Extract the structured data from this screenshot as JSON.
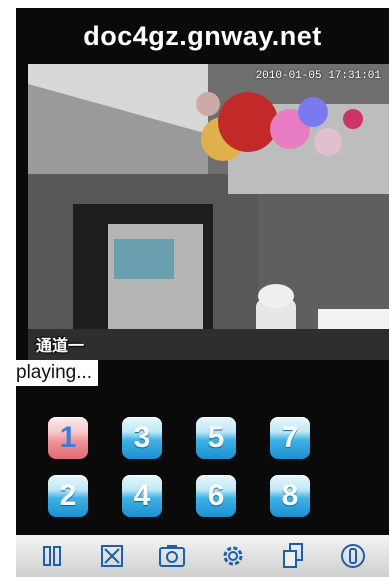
{
  "header": {
    "title": "doc4gz.gnway.net"
  },
  "video": {
    "timestamp": "2010-01-05 17:31:01",
    "channel_label": "通道一"
  },
  "status": {
    "text": "playing..."
  },
  "channels": [
    {
      "label": "1",
      "active": true
    },
    {
      "label": "2",
      "active": false
    },
    {
      "label": "3",
      "active": false
    },
    {
      "label": "4",
      "active": false
    },
    {
      "label": "5",
      "active": false
    },
    {
      "label": "6",
      "active": false
    },
    {
      "label": "7",
      "active": false
    },
    {
      "label": "8",
      "active": false
    }
  ],
  "toolbar": {
    "icons": [
      "pause-icon",
      "stop-icon",
      "camera-icon",
      "settings-icon",
      "copy-icon",
      "info-icon"
    ],
    "icon_color": "#1d5fa8"
  }
}
